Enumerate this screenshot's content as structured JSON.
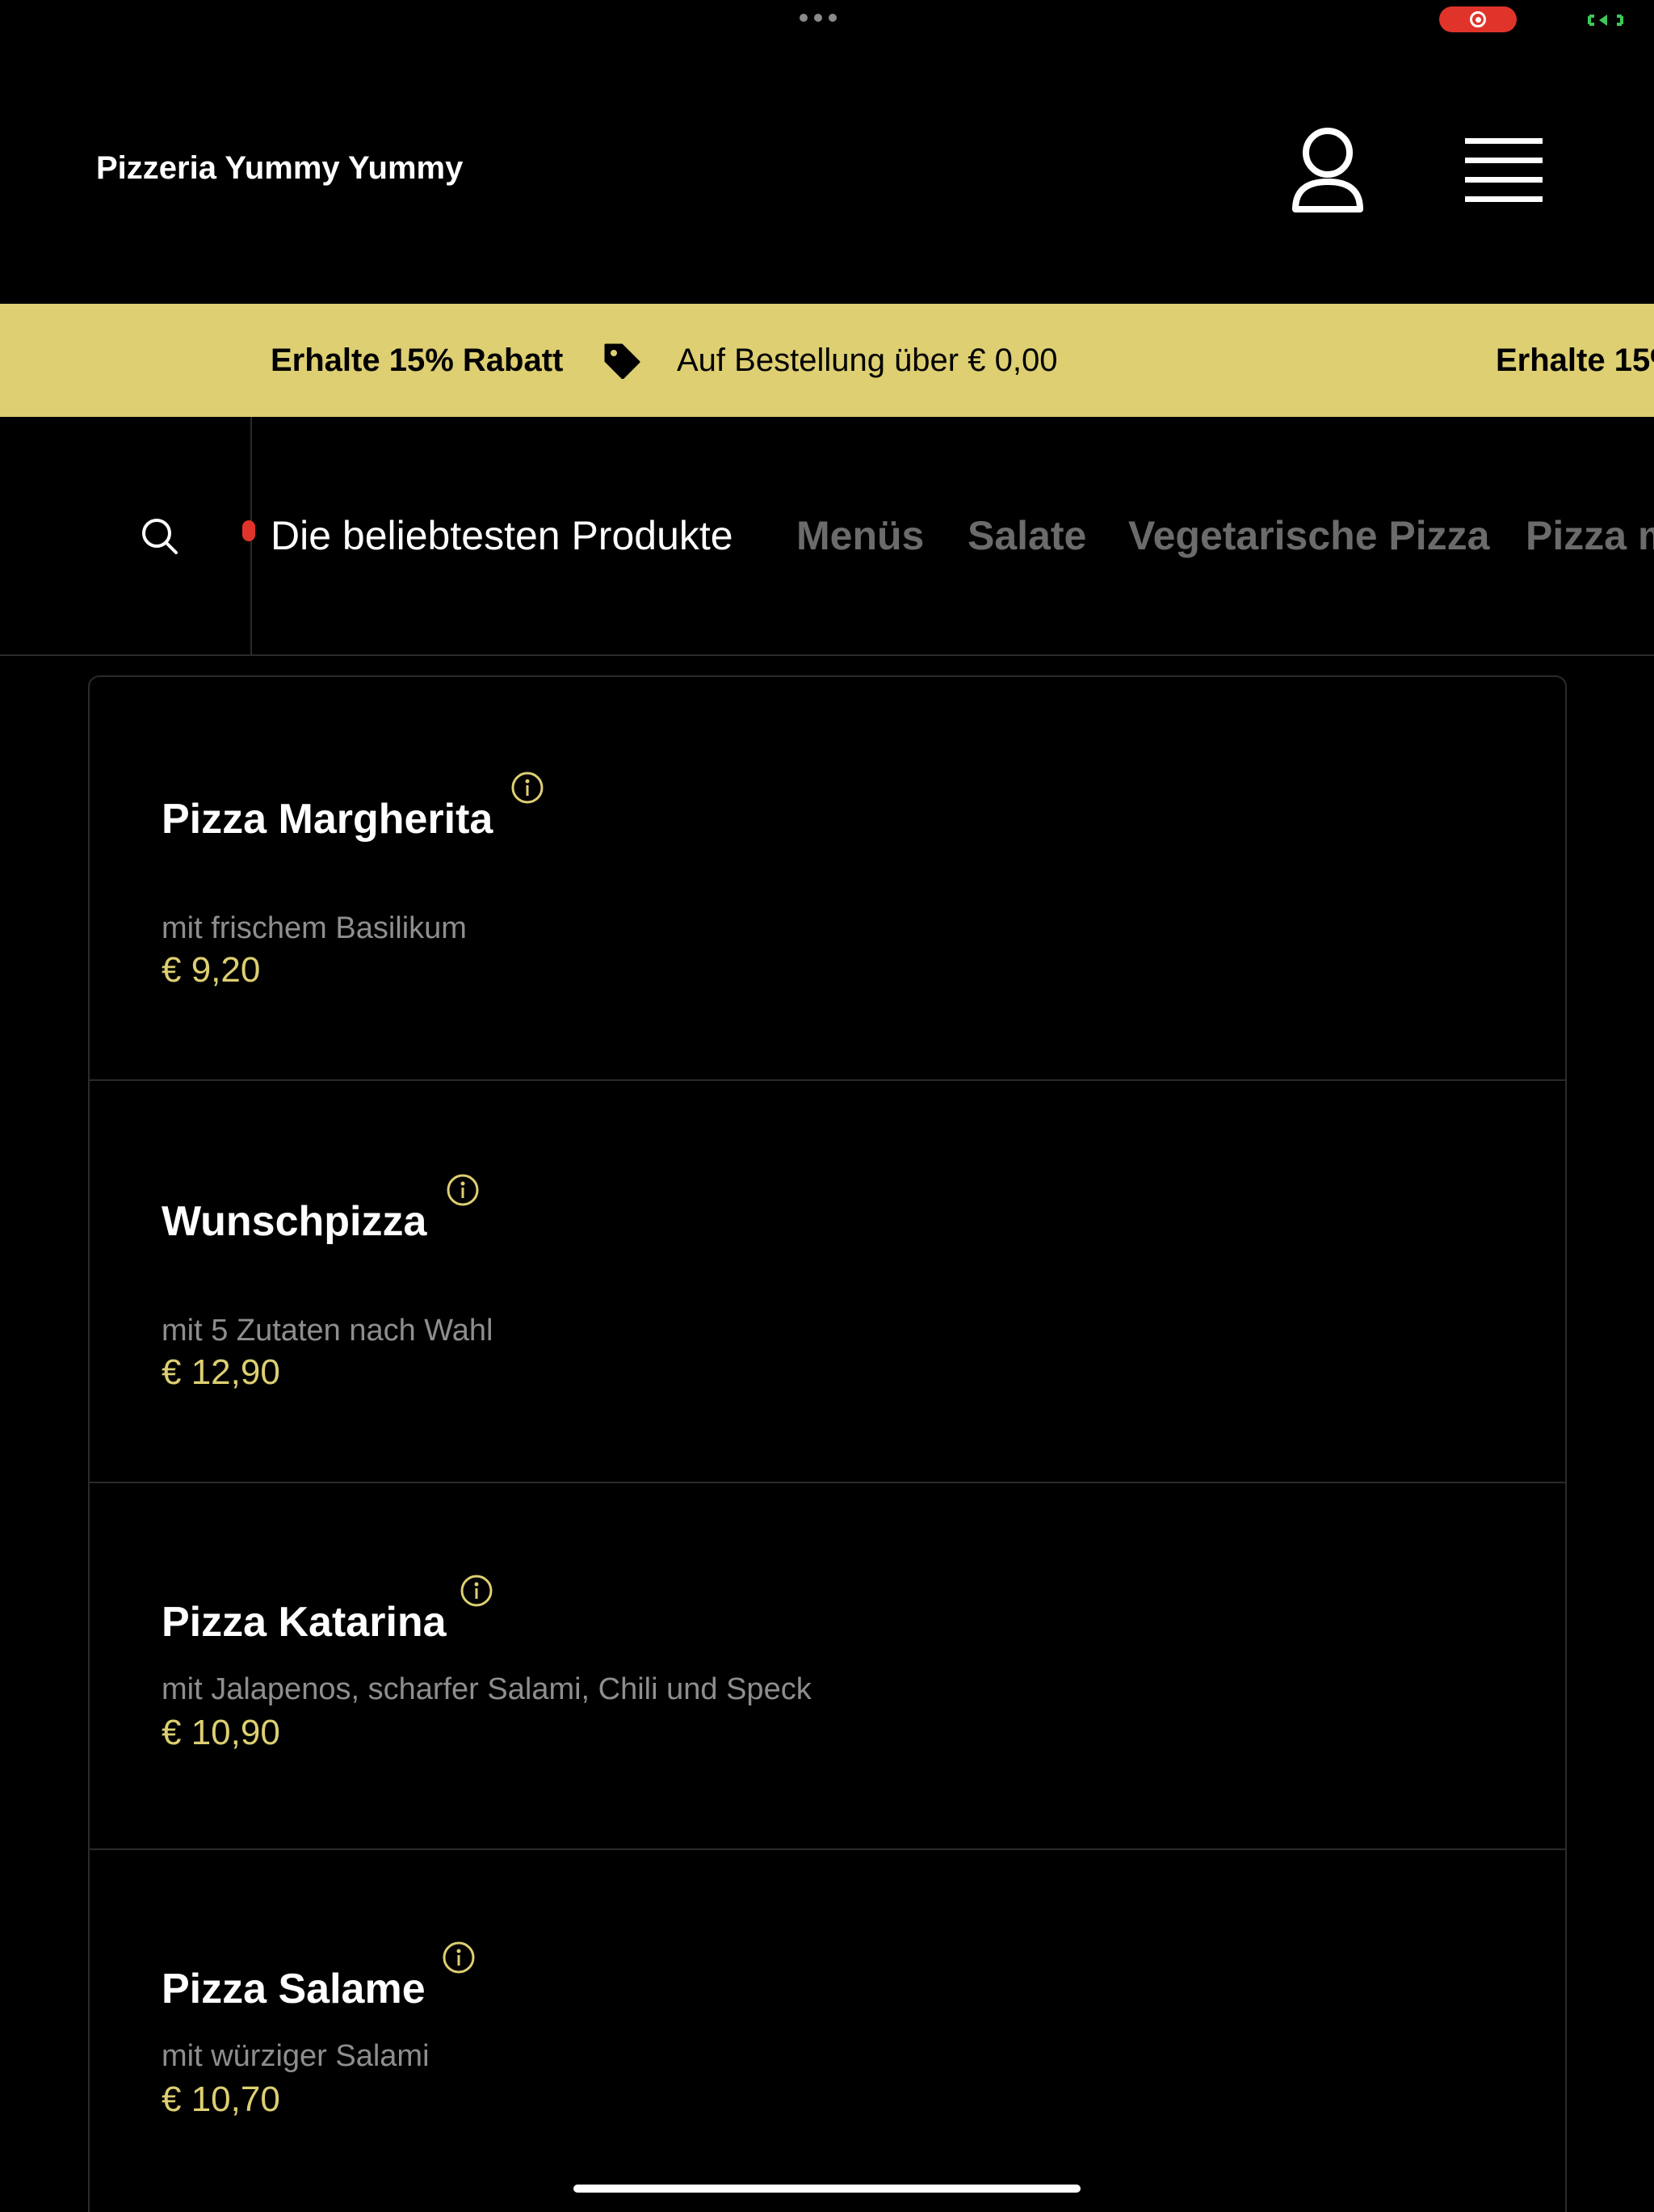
{
  "header": {
    "title": "Pizzeria Yummy Yummy"
  },
  "promo": {
    "headline": "Erhalte 15% Rabatt",
    "condition": "Auf Bestellung über € 0,00",
    "headline_repeat": "Erhalte 15%"
  },
  "nav": {
    "tabs": [
      {
        "label": "Die beliebtesten Produkte",
        "active": true
      },
      {
        "label": "Menüs",
        "active": false
      },
      {
        "label": "Salate",
        "active": false
      },
      {
        "label": "Vegetarische Pizza",
        "active": false
      },
      {
        "label": "Pizza m",
        "active": false
      }
    ]
  },
  "products": [
    {
      "name": "Pizza Margherita",
      "description": "mit frischem Basilikum",
      "price": "€ 9,20"
    },
    {
      "name": "Wunschpizza",
      "description": "mit 5 Zutaten nach Wahl",
      "price": "€ 12,90"
    },
    {
      "name": "Pizza Katarina",
      "description": "mit Jalapenos, scharfer Salami, Chili und Speck",
      "price": "€ 10,90"
    },
    {
      "name": "Pizza Salame",
      "description": "mit würziger Salami",
      "price": "€ 10,70"
    }
  ],
  "colors": {
    "background": "#000000",
    "accent": "#ddcf72",
    "muted_text": "#8e8e8e",
    "inactive_tab": "#6b6b6b",
    "record": "#e0342a"
  },
  "icons": [
    "user-icon",
    "menu-icon",
    "tag-icon",
    "search-icon",
    "info-icon",
    "record-icon"
  ]
}
